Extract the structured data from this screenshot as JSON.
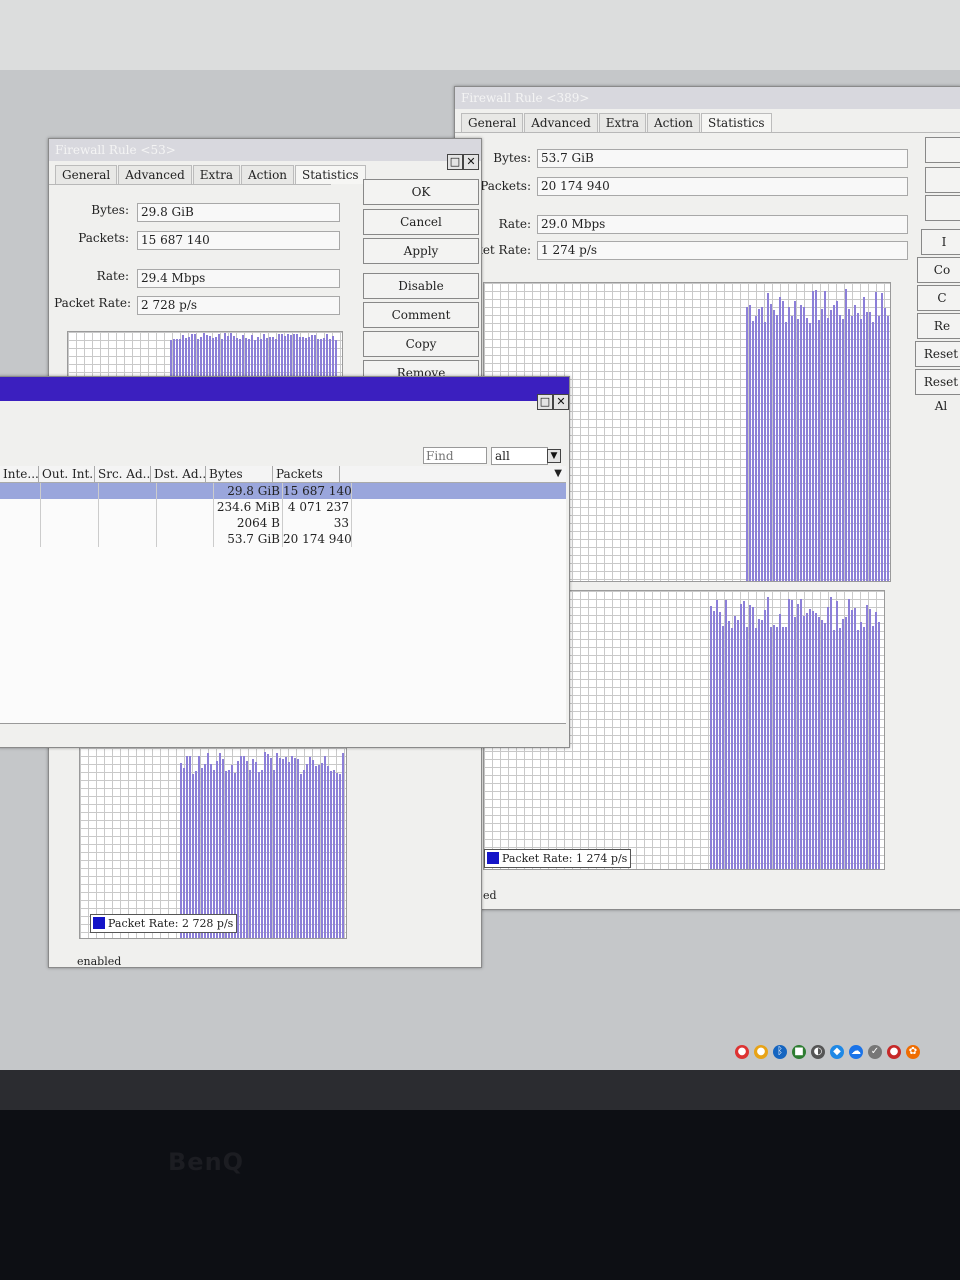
{
  "monitor": {
    "brand": "BenQ"
  },
  "window_389": {
    "title": "Firewall Rule <389>",
    "tabs": [
      "General",
      "Advanced",
      "Extra",
      "Action",
      "Statistics"
    ],
    "bytes_label": "Bytes:",
    "bytes": "53.7 GiB",
    "packets_label": "Packets:",
    "packets": "20 174 940",
    "rate_label": "Rate:",
    "rate": "29.0 Mbps",
    "packet_rate_label": "ket Rate:",
    "packet_rate": "1 274 p/s",
    "legend": "Packet Rate:  1 274 p/s",
    "status": "ed",
    "buttons": [
      "",
      "",
      "",
      "I",
      "Co",
      "C",
      "Re",
      "Reset",
      "Reset Al"
    ]
  },
  "window_53": {
    "title": "Firewall Rule <53>",
    "tabs": [
      "General",
      "Advanced",
      "Extra",
      "Action",
      "Statistics"
    ],
    "bytes_label": "Bytes:",
    "bytes": "29.8 GiB",
    "packets_label": "Packets:",
    "packets": "15 687 140",
    "rate_label": "Rate:",
    "rate": "29.4 Mbps",
    "packet_rate_label": "Packet Rate:",
    "packet_rate": "2 728 p/s",
    "buttons": {
      "ok": "OK",
      "cancel": "Cancel",
      "apply": "Apply",
      "disable": "Disable",
      "comment": "Comment",
      "copy": "Copy",
      "remove": "Remove"
    },
    "legend": "Packet Rate:  2 728 p/s",
    "status": "enabled"
  },
  "list_window": {
    "find_placeholder": "Find",
    "filter_value": "all",
    "columns": [
      "Inte...",
      "Out. Int...",
      "Src. Ad...",
      "Dst. Ad...",
      "Bytes",
      "Packets"
    ],
    "rows": [
      {
        "bytes": "29.8 GiB",
        "packets": "15 687 140",
        "selected": true
      },
      {
        "bytes": "234.6 MiB",
        "packets": "4 071 237",
        "selected": false
      },
      {
        "bytes": "2064 B",
        "packets": "33",
        "selected": false
      },
      {
        "bytes": "53.7 GiB",
        "packets": "20 174 940",
        "selected": false
      }
    ]
  },
  "colors": {
    "bar": "#8c7fd8",
    "list_title": "#3b1fbf",
    "selection": "#9aa6dc",
    "legend_swatch": "#1414c8"
  }
}
